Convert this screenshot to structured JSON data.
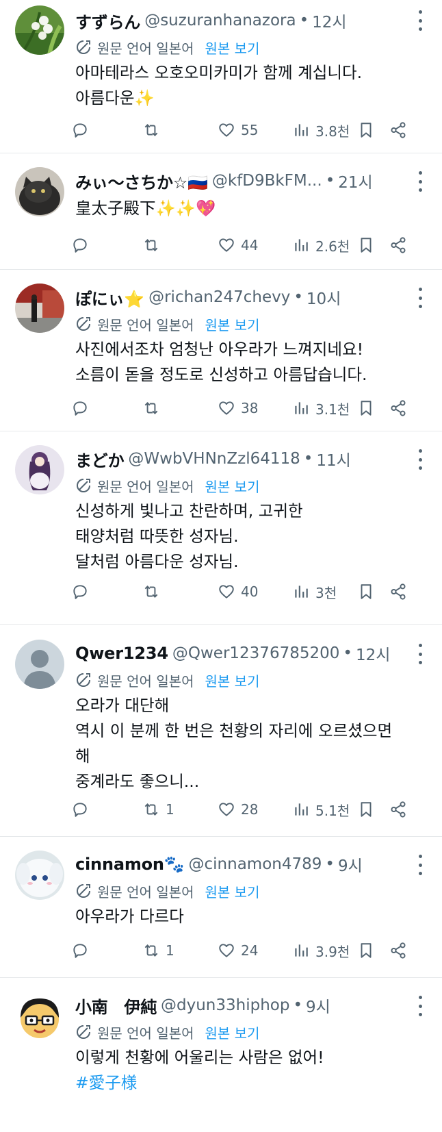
{
  "translate_lang_label": "원문 언어 일본어",
  "translate_show_original": "원본 보기",
  "dot": "•",
  "tweets": [
    {
      "name": "すずらん",
      "handle": "@suzuranhanazora",
      "time": "12시",
      "text": [
        "아마테라스 오호오미카미가 함께 계십니다.",
        "아름다운✨"
      ],
      "replies": "",
      "retweets": "",
      "likes": "55",
      "views": "3.8천",
      "translated": true
    },
    {
      "name": "みぃ〜さちか☆🇷🇺",
      "handle": "@kfD9BkFM...",
      "time": "21시",
      "text": [
        "皇太子殿下✨✨💖"
      ],
      "replies": "",
      "retweets": "",
      "likes": "44",
      "views": "2.6천",
      "translated": false
    },
    {
      "name": "ぽにぃ⭐",
      "handle": "@richan247chevy",
      "time": "10시",
      "text": [
        "사진에서조차 엄청난 아우라가 느껴지네요!",
        "소름이 돋을 정도로 신성하고 아름답습니다."
      ],
      "replies": "",
      "retweets": "",
      "likes": "38",
      "views": "3.1천",
      "translated": true
    },
    {
      "name": "まどか",
      "handle": "@WwbVHNnZzl64118",
      "time": "11시",
      "text": [
        "신성하게 빛나고 찬란하며, 고귀한",
        "태양처럼 따뜻한 성자님.",
        "달처럼 아름다운 성자님."
      ],
      "replies": "",
      "retweets": "",
      "likes": "40",
      "views": "3천",
      "translated": true
    },
    {
      "name": "Qwer1234",
      "handle": "@Qwer12376785200",
      "time": "12시",
      "text": [
        "오라가 대단해",
        "역시 이 분께 한 번은 천황의 자리에 오르셨으면",
        "해",
        "중계라도 좋으니..."
      ],
      "replies": "",
      "retweets": "1",
      "likes": "28",
      "views": "5.1천",
      "translated": true
    },
    {
      "name": "cinnamon🐾",
      "handle": "@cinnamon4789",
      "time": "9시",
      "text": [
        "아우라가 다르다"
      ],
      "replies": "",
      "retweets": "1",
      "likes": "24",
      "views": "3.9천",
      "translated": true
    },
    {
      "name": "小南　伊純",
      "handle": "@dyun33hiphop",
      "time": "9시",
      "text": [
        "이렇게 천황에 어울리는 사람은 없어!",
        "#愛子様"
      ],
      "replies": "",
      "retweets": "",
      "likes": "",
      "views": "",
      "translated": true
    }
  ],
  "colors": {
    "accent": "#1d9bf0",
    "secondary_text": "#536471",
    "primary_text": "#0f1419",
    "divider": "#e6e9eb"
  },
  "icons": [
    "reply-icon",
    "retweet-icon",
    "heart-icon",
    "views-icon",
    "bookmark-icon",
    "share-icon",
    "translate-icon",
    "more-icon"
  ]
}
